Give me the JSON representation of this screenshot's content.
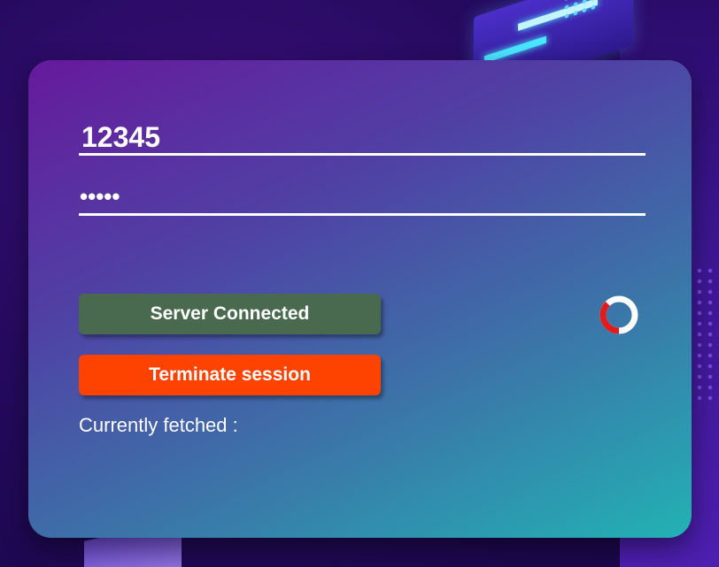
{
  "login": {
    "username_value": "12345",
    "password_value": "•••••"
  },
  "buttons": {
    "status_label": "Server Connected",
    "terminate_label": "Terminate session"
  },
  "status": {
    "fetched_label": "Currently fetched :"
  },
  "icons": {
    "loading": "loading-spinner-icon"
  },
  "colors": {
    "status_button": "#496a4f",
    "terminate_button": "#fe4200",
    "spinner_accent": "#e41b1b",
    "spinner_track": "#ffffff"
  }
}
